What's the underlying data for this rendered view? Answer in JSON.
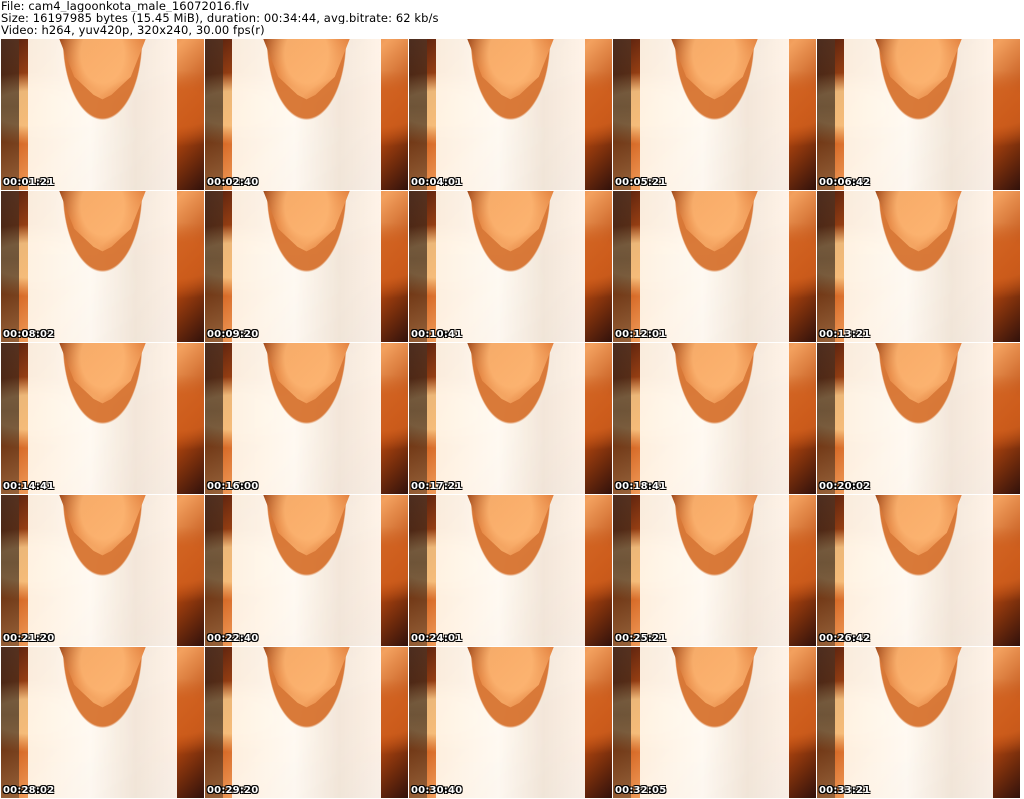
{
  "header": {
    "file": "File: cam4_lagoonkota_male_16072016.flv",
    "size": "Size: 16197985 bytes (15.45 MiB), duration: 00:34:44, avg.bitrate: 62 kb/s",
    "video": "Video: h264, yuv420p, 320x240, 30.00 fps(r)"
  },
  "thumbnails": [
    {
      "timestamp": "00:01:21"
    },
    {
      "timestamp": "00:02:40"
    },
    {
      "timestamp": "00:04:01"
    },
    {
      "timestamp": "00:05:21"
    },
    {
      "timestamp": "00:06:42"
    },
    {
      "timestamp": "00:08:02"
    },
    {
      "timestamp": "00:09:20"
    },
    {
      "timestamp": "00:10:41"
    },
    {
      "timestamp": "00:12:01"
    },
    {
      "timestamp": "00:13:21"
    },
    {
      "timestamp": "00:14:41"
    },
    {
      "timestamp": "00:16:00"
    },
    {
      "timestamp": "00:17:21"
    },
    {
      "timestamp": "00:18:41"
    },
    {
      "timestamp": "00:20:02"
    },
    {
      "timestamp": "00:21:20"
    },
    {
      "timestamp": "00:22:40"
    },
    {
      "timestamp": "00:24:01"
    },
    {
      "timestamp": "00:25:21"
    },
    {
      "timestamp": "00:26:42"
    },
    {
      "timestamp": "00:28:02"
    },
    {
      "timestamp": "00:29:20"
    },
    {
      "timestamp": "00:30:40"
    },
    {
      "timestamp": "00:32:05"
    },
    {
      "timestamp": "00:33:21"
    }
  ]
}
